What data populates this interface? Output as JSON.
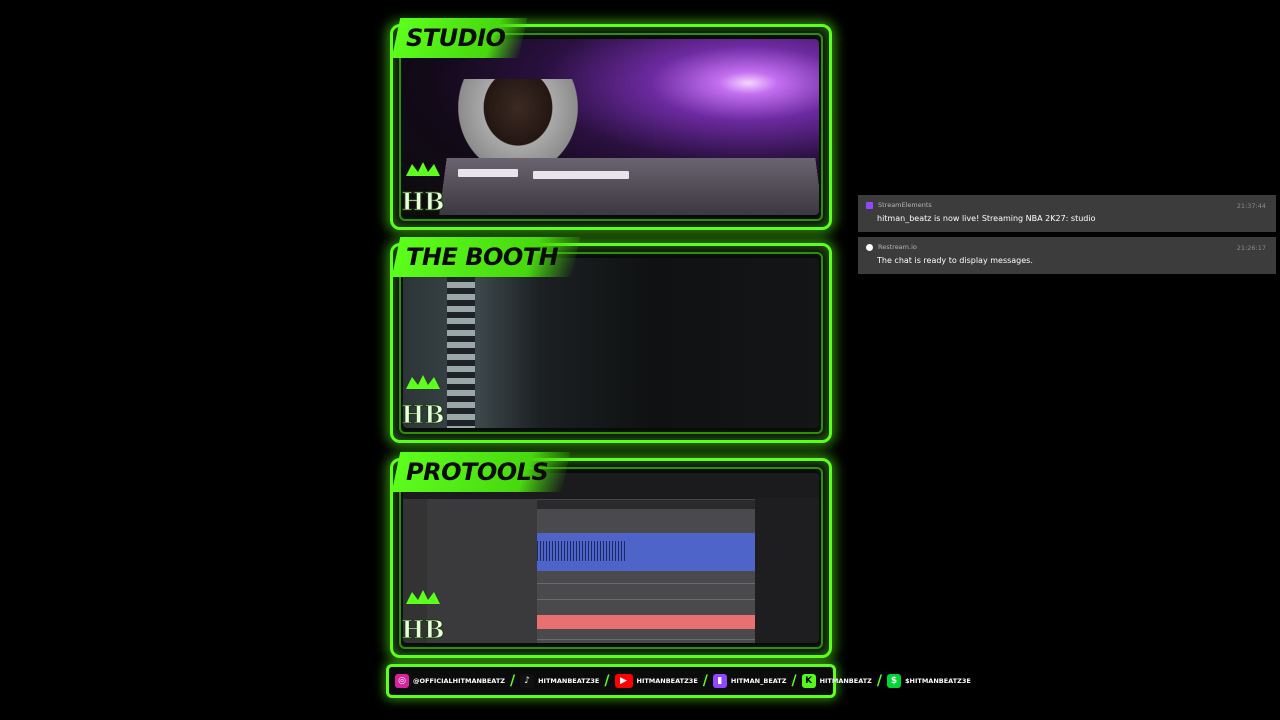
{
  "panels": {
    "studio": {
      "title": "STUDIO"
    },
    "booth": {
      "title": "THE BOOTH"
    },
    "protools": {
      "title": "PROTOOLS"
    }
  },
  "logo": {
    "initials": "HB"
  },
  "social": [
    {
      "platform": "instagram",
      "icon": "instagram-icon",
      "handle": "@OFFICIALHITMANBEATZ",
      "color": "#d6249f"
    },
    {
      "platform": "tiktok",
      "icon": "tiktok-icon",
      "handle": "HITMANBEATZ3E",
      "color": "#111111"
    },
    {
      "platform": "youtube",
      "icon": "youtube-icon",
      "handle": "HITMANBEATZ3E",
      "color": "#ff0000"
    },
    {
      "platform": "twitch",
      "icon": "twitch-icon",
      "handle": "HITMAN_BEATZ",
      "color": "#9146ff"
    },
    {
      "platform": "kick",
      "icon": "kick-icon",
      "handle": "HITMANBEATZ",
      "color": "#53fc18"
    },
    {
      "platform": "cashapp",
      "icon": "cashapp-icon",
      "handle": "$HITMANBEATZ3E",
      "color": "#00d632"
    }
  ],
  "chat": {
    "messages": [
      {
        "source": "StreamElements",
        "time": "21:37:44",
        "text": "hitman_beatz is now live! Streaming NBA 2K27: studio",
        "icon_color": "#9146ff"
      },
      {
        "source": "Restream.io",
        "time": "21:26:17",
        "text": "The chat is ready to display messages.",
        "icon_color": "#ffffff"
      }
    ]
  },
  "colors": {
    "accent": "#5dff1c",
    "chat_bg": "#3c3c3c"
  }
}
